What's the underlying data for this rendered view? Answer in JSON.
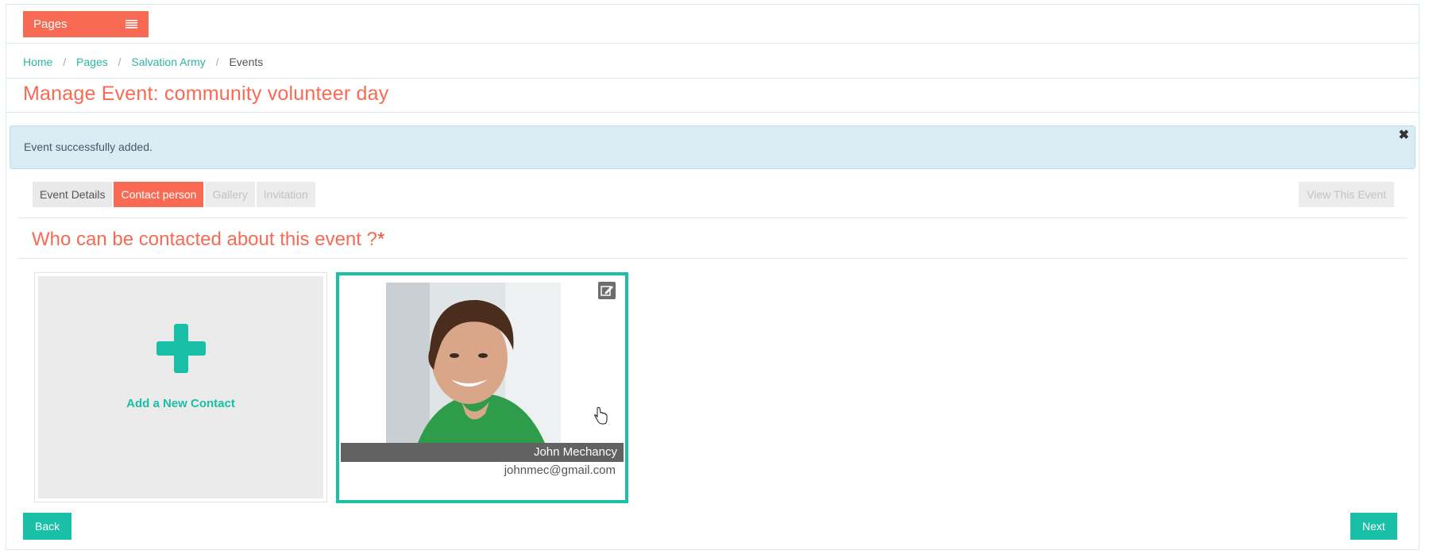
{
  "topbar": {
    "pages_label": "Pages",
    "menu_icon": "hamburger-icon"
  },
  "breadcrumb": {
    "items": [
      "Home",
      "Pages",
      "Salvation Army"
    ],
    "current": "Events",
    "separator": "/"
  },
  "title": "Manage Event: community volunteer day",
  "alert": {
    "message": "Event successfully added.",
    "close": "✖"
  },
  "tabs": [
    "Event Details",
    "Contact person",
    "Gallery",
    "Invitation"
  ],
  "view_event_label": "View This Event",
  "section": {
    "title": "Who can be contacted about this event ?",
    "required_mark": "*"
  },
  "add_contact": {
    "label": "Add a New Contact",
    "icon": "plus-icon"
  },
  "contact": {
    "name": "John Mechancy",
    "email": "johnmec@gmail.com",
    "edit_icon": "edit-icon"
  },
  "buttons": {
    "back": "Back",
    "next": "Next"
  },
  "colors": {
    "accent": "#f86a53",
    "teal": "#19bfa6",
    "link": "#2bb5a4",
    "alert_bg": "#d9ecf4"
  }
}
